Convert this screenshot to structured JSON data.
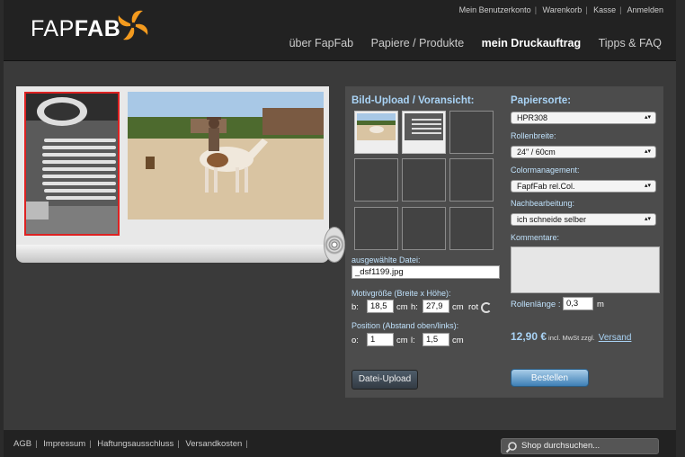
{
  "brand": {
    "logo_light": "FAP",
    "logo_bold": "FAB"
  },
  "top_links": [
    "Mein Benutzerkonto",
    "Warenkorb",
    "Kasse",
    "Anmelden"
  ],
  "main_nav": [
    {
      "label": "über FapFab"
    },
    {
      "label": "Papiere / Produkte"
    },
    {
      "label": "mein Druckauftrag"
    },
    {
      "label": "Tipps & FAQ"
    }
  ],
  "upload": {
    "title": "Bild-Upload / Voransicht:",
    "selected_label": "ausgewählte Datei:",
    "selected_file": "_dsf1199.jpg",
    "size_label": "Motivgröße (Breite x Höhe):",
    "width_label": "b:",
    "width_value": "18,5",
    "width_unit": "cm",
    "height_label": "h:",
    "height_value": "27,9",
    "height_unit": "cm",
    "rotate_label": "rot",
    "position_label": "Position (Abstand oben/links):",
    "top_label": "o:",
    "top_value": "1",
    "top_unit": "cm",
    "left_label": "l:",
    "left_value": "1,5",
    "left_unit": "cm",
    "upload_button": "Datei-Upload"
  },
  "options": {
    "paper_title": "Papiersorte:",
    "paper_value": "HPR308",
    "roll_width_label": "Rollenbreite:",
    "roll_width_value": "24\" / 60cm",
    "color_mgmt_label": "Colormanagement:",
    "color_mgmt_value": "FapfFab rel.Col.",
    "post_label": "Nachbearbeitung:",
    "post_value": "ich schneide selber",
    "comment_label": "Kommentare:",
    "roll_length_label": "Rollenlänge :",
    "roll_length_value": "0,3",
    "roll_length_unit": "m",
    "price": "12,90 €",
    "price_note": "incl. MwSt zzgl.",
    "shipping_link": "Versand",
    "order_button": "Bestellen"
  },
  "footer": {
    "links": [
      "AGB",
      "Impressum",
      "Haftungsausschluss",
      "Versandkosten"
    ],
    "search_placeholder": "Shop durchsuchen..."
  },
  "colors": {
    "accent": "#a9d3f5",
    "highlight_border": "#dd2222",
    "brand_orange": "#f39a1e"
  }
}
